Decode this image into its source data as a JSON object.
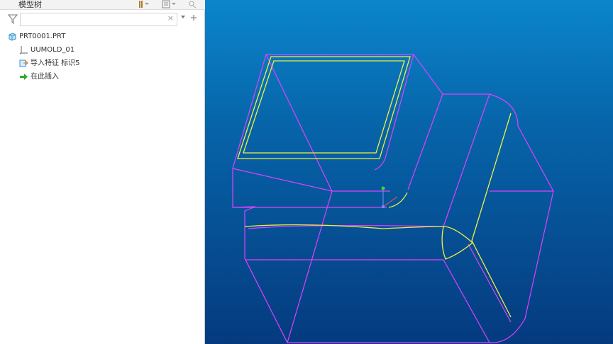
{
  "panel": {
    "title": "模型树"
  },
  "filter": {
    "search_value": "",
    "clear_glyph": "×"
  },
  "tree": {
    "items": [
      {
        "label": "PRT0001.PRT",
        "icon": "part-icon"
      },
      {
        "label": "UUMOLD_01",
        "icon": "coordinate-system-icon"
      },
      {
        "label": "导入特征 标识5",
        "icon": "import-feature-icon"
      },
      {
        "label": "在此插入",
        "icon": "insert-here-arrow-icon"
      }
    ]
  },
  "colors": {
    "sidebar_bg": "#ffffff",
    "viewport_top": "#0b86cc",
    "viewport_bottom": "#053a7f",
    "edge_magenta": "#e040ff",
    "edge_yellow": "#f0f040",
    "insert_arrow": "#2ea82e"
  }
}
